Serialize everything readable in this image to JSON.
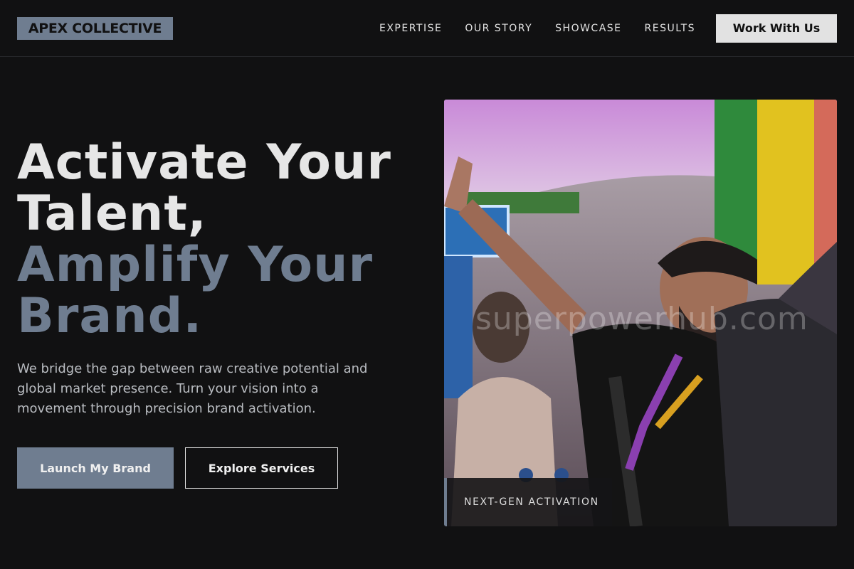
{
  "brand": {
    "logo": "APEX COLLECTIVE"
  },
  "nav": {
    "links": [
      "EXPERTISE",
      "OUR STORY",
      "SHOWCASE",
      "RESULTS"
    ],
    "cta": "Work With Us"
  },
  "hero": {
    "title_lines": [
      "Activate Your",
      "Talent,",
      "Amplify Your",
      "Brand."
    ],
    "subtitle": "We bridge the gap between raw creative potential and global market presence. Turn your vision into a movement through precision brand activation.",
    "primary_button": "Launch My Brand",
    "secondary_button": "Explore Services"
  },
  "image": {
    "watermark": "superpowerhub.com",
    "tag": "NEXT-GEN ACTIVATION"
  },
  "colors": {
    "background": "#111112",
    "accent": "#6f7d90",
    "text": "#e6e6e6"
  }
}
